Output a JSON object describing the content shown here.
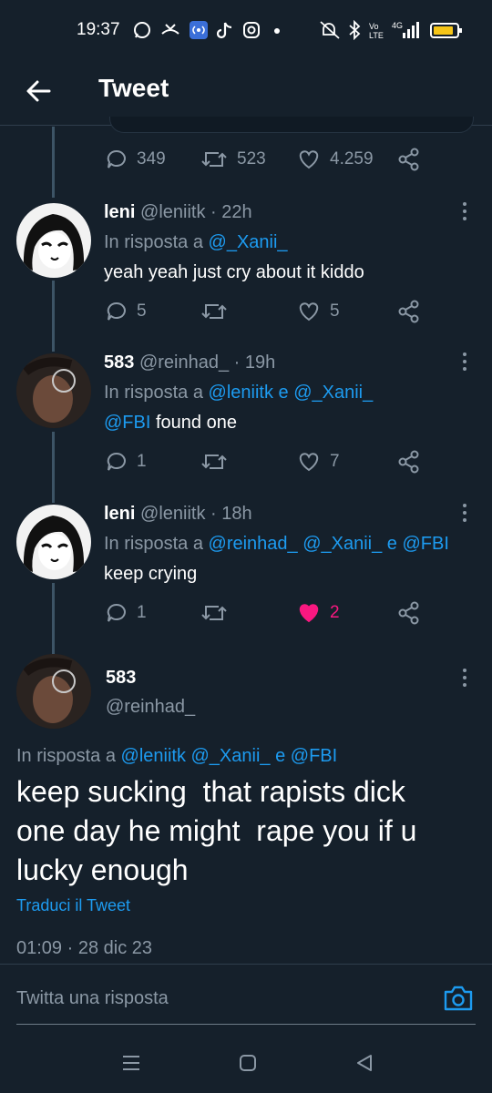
{
  "status_bar": {
    "time": "19:37",
    "left_icons": [
      "whatsapp-icon",
      "missed-call-icon",
      "hotspot-icon",
      "tiktok-icon",
      "instagram-icon",
      "dot-icon"
    ],
    "right_icons": [
      "mute-icon",
      "bluetooth-icon",
      "volte-icon",
      "signal-4g-icon",
      "battery-icon"
    ],
    "network_label": "4G"
  },
  "header": {
    "title": "Tweet",
    "back_icon": "arrow-left-icon"
  },
  "top_tweet": {
    "replies": "349",
    "retweets": "523",
    "likes": "4.259"
  },
  "replies": [
    {
      "name": "leni",
      "handle": "@leniitk",
      "time": "· 22h",
      "reply_prefix": "In risposta a",
      "reply_to": "@_Xanii_",
      "text": "yeah yeah just cry about it kiddo",
      "replies": "5",
      "retweets": "",
      "likes": "5",
      "liked": false
    },
    {
      "name": "583",
      "handle": "@reinhad_",
      "time": "· 19h",
      "reply_prefix": "In risposta a",
      "reply_to": "@leniitk e @_Xanii_",
      "text_mention": "@FBI",
      "text": "found one",
      "replies": "1",
      "retweets": "",
      "likes": "7",
      "liked": false
    },
    {
      "name": "leni",
      "handle": "@leniitk",
      "time": "· 18h",
      "reply_prefix": "In risposta a",
      "reply_to": "@reinhad_ @_Xanii_ e @FBI",
      "text": "keep crying",
      "replies": "1",
      "retweets": "",
      "likes": "2",
      "liked": true
    }
  ],
  "main_tweet": {
    "name": "583",
    "handle": "@reinhad_",
    "reply_prefix": "In risposta a",
    "reply_to": "@leniitk @_Xanii_ e @FBI",
    "text_line1": "keep sucking  that rapists dick",
    "text_line2": "one day he might  rape you if u",
    "text_line3": "lucky enough",
    "translate": "Traduci il Tweet",
    "timestamp": "01:09 · 28 dic 23"
  },
  "compose": {
    "placeholder": "Twitta una risposta"
  },
  "colors": {
    "background": "#15202b",
    "accent": "#1d9bf0",
    "secondary_text": "#8b98a5",
    "like_active": "#f91880"
  }
}
